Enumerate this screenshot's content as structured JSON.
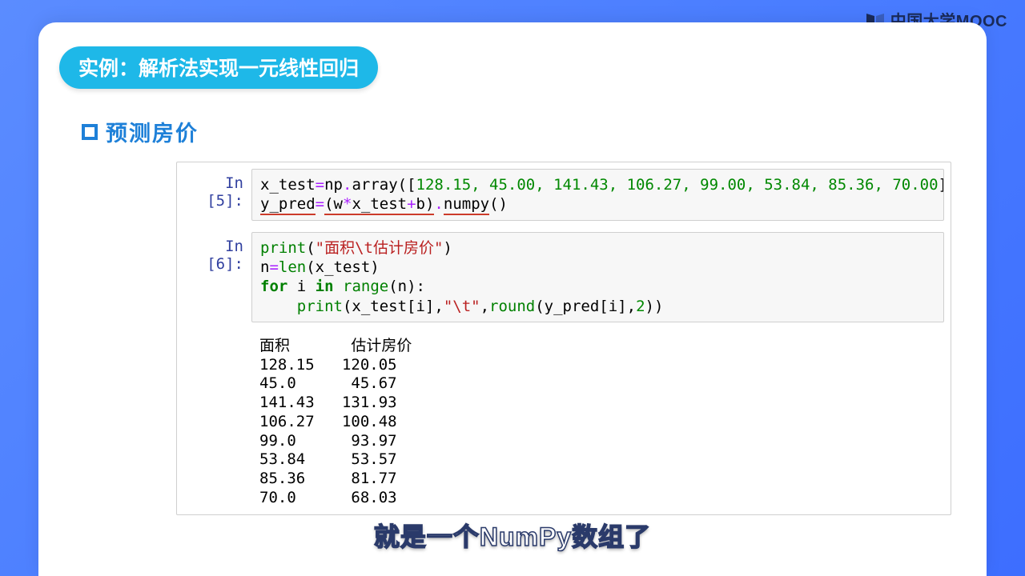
{
  "watermark": {
    "text": "中国大学MOOC",
    "icon": "book-icon"
  },
  "header": {
    "pill": "实例：解析法实现一元线性回归"
  },
  "section": {
    "title": "预测房价"
  },
  "cells": [
    {
      "prompt": "In [5]:",
      "code": {
        "line1_a": "x_test",
        "line1_eq": "=",
        "line1_b": "np",
        "line1_dot": ".",
        "line1_c": "array([",
        "line1_nums": "128.15, 45.00, 141.43, 106.27, 99.00, 53.84, 85.36, 70.00",
        "line1_d": "])",
        "line2_a": "y_pred",
        "line2_eq": "=",
        "line2_b": "(w",
        "line2_mul": "*",
        "line2_c": "x_test",
        "line2_plus": "+",
        "line2_d": "b)",
        "line2_dot": ".",
        "line2_e": "numpy",
        "line2_f": "()"
      }
    },
    {
      "prompt": "In [6]:",
      "code": {
        "l1a": "print",
        "l1b": "(",
        "l1c": "\"面积\\t估计房价\"",
        "l1d": ")",
        "l2a": "n",
        "l2eq": "=",
        "l2b": "len",
        "l2c": "(x_test)",
        "l3a": "for",
        "l3b": " i ",
        "l3c": "in",
        "l3d": " ",
        "l3e": "range",
        "l3f": "(n):",
        "l4pad": "    ",
        "l4a": "print",
        "l4b": "(x_test[i],",
        "l4c": "\"\\t\"",
        "l4d": ",",
        "l4e": "round",
        "l4f": "(y_pred[i],",
        "l4g": "2",
        "l4h": "))"
      }
    }
  ],
  "output": {
    "header": "面积\t  估计房价",
    "rows": [
      "128.15\t 120.05",
      "45.0\t  45.67",
      "141.43\t 131.93",
      "106.27\t 100.48",
      "99.0\t  93.97",
      "53.84\t  53.57",
      "85.36\t  81.77",
      "70.0\t  68.03"
    ]
  },
  "subtitle": "就是一个NumPy数组了"
}
